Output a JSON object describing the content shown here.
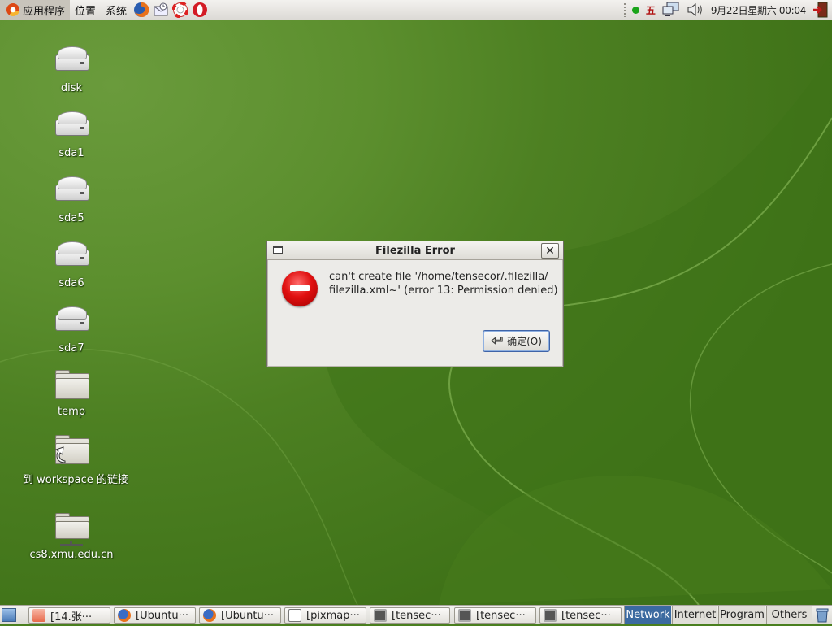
{
  "top_panel": {
    "menus": [
      "应用程序",
      "位置",
      "系统"
    ],
    "launchers": [
      "firefox-icon",
      "evolution-icon",
      "help-icon",
      "opera-icon"
    ],
    "ime_label": "五",
    "clock": "9月22日星期六 00:04"
  },
  "desktop_icons": [
    {
      "label": "disk",
      "icon": "drive-icon"
    },
    {
      "label": "sda1",
      "icon": "drive-icon"
    },
    {
      "label": "sda5",
      "icon": "drive-icon"
    },
    {
      "label": "sda6",
      "icon": "drive-icon"
    },
    {
      "label": "sda7",
      "icon": "drive-icon"
    },
    {
      "label": "temp",
      "icon": "folder-icon"
    },
    {
      "label": "到 workspace 的链接",
      "icon": "folder-link-icon"
    },
    {
      "label": "cs8.xmu.edu.cn",
      "icon": "network-folder-icon"
    }
  ],
  "dialog": {
    "title": "Filezilla Error",
    "message_line1": "can't create file '/home/tensecor/.filezilla/",
    "message_line2": "filezilla.xml~' (error 13: Permission denied)",
    "ok_label": "确定(O)"
  },
  "taskbar": {
    "tasks": [
      {
        "label": "[14.张···",
        "icon": "image-icon"
      },
      {
        "label": "[Ubuntu···",
        "icon": "firefox-icon"
      },
      {
        "label": "[Ubuntu···",
        "icon": "firefox-icon"
      },
      {
        "label": "[pixmap···",
        "icon": "document-icon"
      },
      {
        "label": "[tensec···",
        "icon": "terminal-icon"
      },
      {
        "label": "[tensec···",
        "icon": "terminal-icon"
      },
      {
        "label": "[tensec···",
        "icon": "terminal-icon"
      }
    ],
    "workspaces": [
      "Network",
      "Internet",
      "Program",
      "Others"
    ],
    "active_workspace": "Network"
  },
  "colors": {
    "workspace_active": "#3b6aa0",
    "desktop_green": "#4d8022",
    "error_red": "#e01010"
  }
}
